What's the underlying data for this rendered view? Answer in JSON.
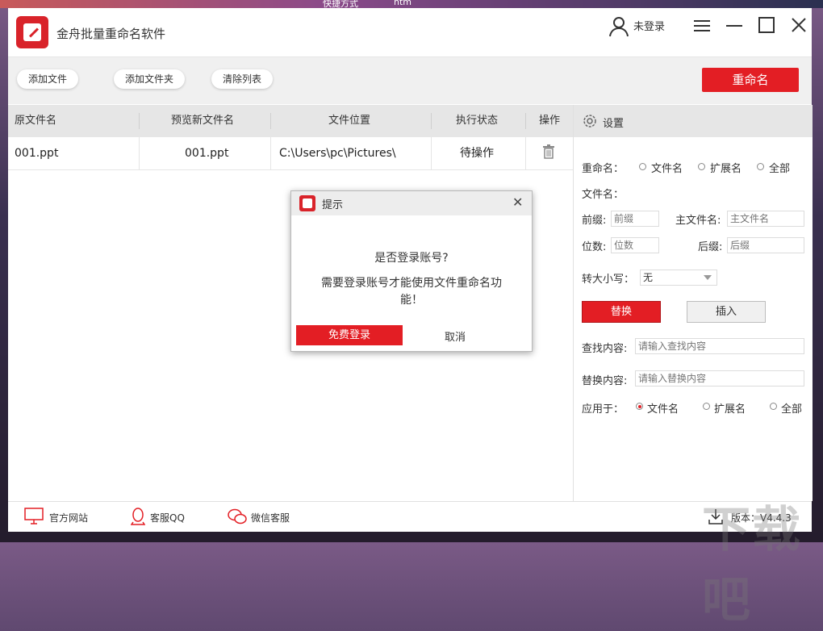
{
  "desktop": {
    "text1": "快捷方式",
    "text2": "htm"
  },
  "app": {
    "title": "金舟批量重命名软件"
  },
  "header": {
    "user_label": "未登录"
  },
  "toolbar": {
    "add_file": "添加文件",
    "add_folder": "添加文件夹",
    "clear_list": "清除列表",
    "rename": "重命名"
  },
  "table": {
    "columns": [
      "原文件名",
      "预览新文件名",
      "文件位置",
      "执行状态",
      "操作"
    ],
    "rows": [
      {
        "original": "001.ppt",
        "preview": "001.ppt",
        "location": "C:\\Users\\pc\\Pictures\\",
        "status": "待操作"
      }
    ]
  },
  "panel": {
    "title": "设置",
    "rename_label": "重命名：",
    "rename_options": [
      "文件名",
      "扩展名",
      "全部"
    ],
    "filename_label": "文件名：",
    "prefix_label": "前缀:",
    "prefix_placeholder": "前缀",
    "mainname_label": "主文件名:",
    "mainname_placeholder": "主文件名",
    "digits_label": "位数:",
    "digits_placeholder": "位数",
    "suffix_label": "后缀:",
    "suffix_placeholder": "后缀",
    "case_label": "转大小写：",
    "case_value": "无",
    "replace_btn": "替换",
    "insert_btn": "插入",
    "find_label": "查找内容:",
    "find_placeholder": "请输入查找内容",
    "replace_label": "替换内容:",
    "replace_placeholder": "请输入替换内容",
    "apply_label": "应用于：",
    "apply_options": [
      "文件名",
      "扩展名",
      "全部"
    ],
    "apply_selected": "文件名"
  },
  "statusbar": {
    "website": "官方网站",
    "qq": "客服QQ",
    "wechat": "微信客服",
    "version": "版本：V4.4.3"
  },
  "dialog": {
    "title": "提示",
    "question": "是否登录账号?",
    "message": "需要登录账号才能使用文件重命名功能！",
    "login": "免费登录",
    "cancel": "取消"
  },
  "watermark": "下载吧",
  "colors": {
    "accent": "#e31e24"
  }
}
